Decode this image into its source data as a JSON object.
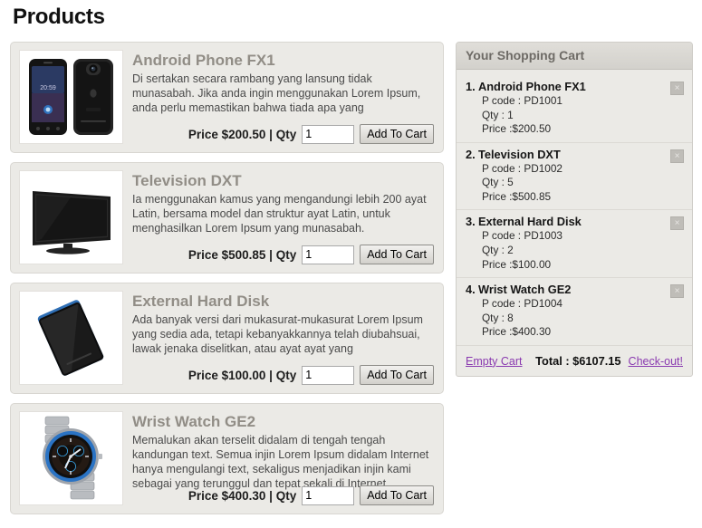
{
  "page": {
    "title": "Products"
  },
  "products": [
    {
      "name": "Android Phone FX1",
      "description": "Di sertakan secara rambang yang lansung tidak munasabah. Jika anda ingin menggunakan Lorem Ipsum, anda perlu memastikan bahwa tiada apa yang",
      "price_label": "Price $200.50 | Qty",
      "qty_value": "1",
      "add_label": "Add To Cart",
      "image": "android-phone-image"
    },
    {
      "name": "Television DXT",
      "description": "Ia menggunakan kamus yang mengandungi lebih 200 ayat Latin, bersama model dan struktur ayat Latin, untuk menghasilkan Lorem Ipsum yang munasabah.",
      "price_label": "Price $500.85 | Qty",
      "qty_value": "1",
      "add_label": "Add To Cart",
      "image": "television-image"
    },
    {
      "name": "External Hard Disk",
      "description": "Ada banyak versi dari mukasurat-mukasurat Lorem Ipsum yang sedia ada, tetapi kebanyakkannya telah diubahsuai, lawak jenaka diselitkan, atau ayat ayat yang",
      "price_label": "Price $100.00 | Qty",
      "qty_value": "1",
      "add_label": "Add To Cart",
      "image": "hard-disk-image"
    },
    {
      "name": "Wrist Watch GE2",
      "description": "Memalukan akan terselit didalam di tengah tengah kandungan text. Semua injin Lorem Ipsum didalam Internet hanya mengulangi text, sekaligus menjadikan injin kami sebagai yang terunggul dan tepat sekali di Internet.",
      "price_label": "Price $400.30 | Qty",
      "qty_value": "1",
      "add_label": "Add To Cart",
      "image": "wrist-watch-image"
    }
  ],
  "cart": {
    "header": "Your Shopping Cart",
    "remove_label": "×",
    "items": [
      {
        "num": "1.",
        "name": "Android Phone FX1",
        "code": "P code : PD1001",
        "qty": "Qty : 1",
        "price": "Price :$200.50"
      },
      {
        "num": "2.",
        "name": "Television DXT",
        "code": "P code : PD1002",
        "qty": "Qty : 5",
        "price": "Price :$500.85"
      },
      {
        "num": "3.",
        "name": "External Hard Disk",
        "code": "P code : PD1003",
        "qty": "Qty : 2",
        "price": "Price :$100.00"
      },
      {
        "num": "4.",
        "name": "Wrist Watch GE2",
        "code": "P code : PD1004",
        "qty": "Qty : 8",
        "price": "Price :$400.30"
      }
    ],
    "empty_label": "Empty Cart",
    "total_label": "Total : $6107.15",
    "checkout_label": "Check-out!",
    "link_color": "#8a3ab0"
  }
}
